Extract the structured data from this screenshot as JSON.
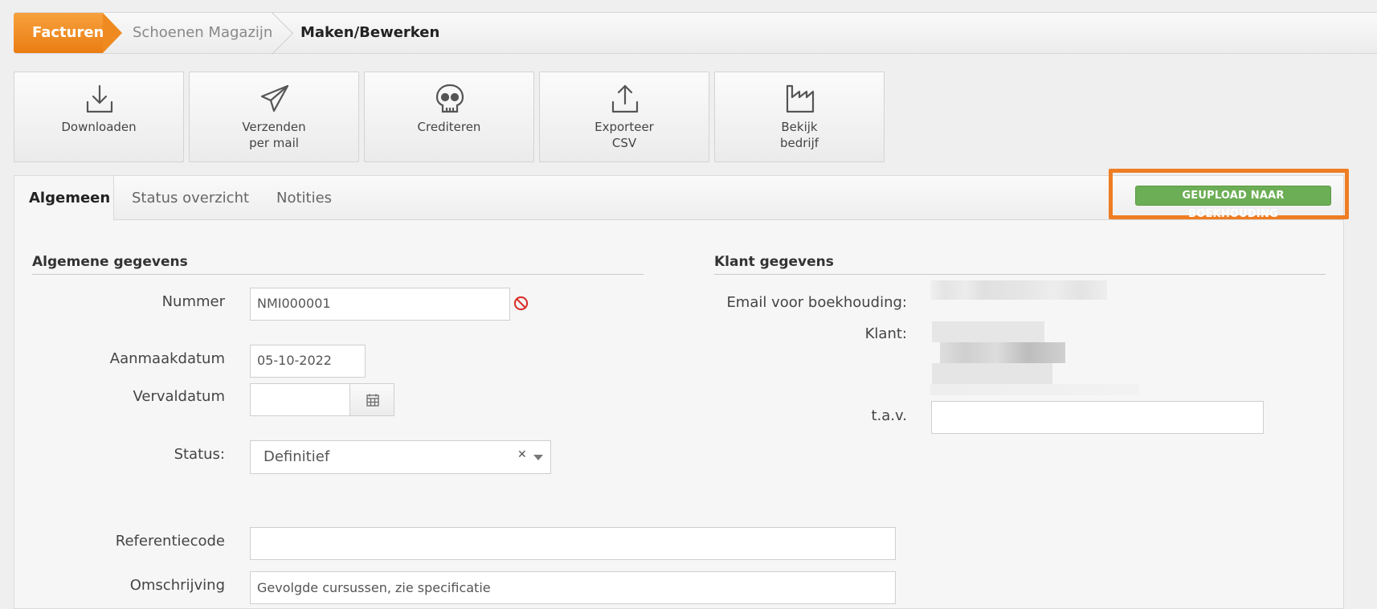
{
  "breadcrumb": {
    "items": [
      "Facturen",
      "Schoenen Magazijn",
      "Maken/Bewerken"
    ]
  },
  "toolbar": {
    "buttons": [
      {
        "icon": "download-icon",
        "lines": [
          "Downloaden"
        ]
      },
      {
        "icon": "paper-plane-icon",
        "lines": [
          "Verzenden",
          "per mail"
        ]
      },
      {
        "icon": "skull-icon",
        "lines": [
          "Crediteren"
        ]
      },
      {
        "icon": "upload-icon",
        "lines": [
          "Exporteer",
          "CSV"
        ]
      },
      {
        "icon": "factory-icon",
        "lines": [
          "Bekijk",
          "bedrijf"
        ]
      }
    ]
  },
  "tabs": {
    "items": [
      "Algemeen",
      "Status overzicht",
      "Notities"
    ],
    "active": "Algemeen"
  },
  "upload_badge": "GEUPLOAD NAAR BOEKHOUDING",
  "general": {
    "title": "Algemene gegevens",
    "number_label": "Nummer",
    "number_value": "NMI000001",
    "created_label": "Aanmaakdatum",
    "created_value": "05-10-2022",
    "due_label": "Vervaldatum",
    "due_value": "",
    "status_label": "Status:",
    "status_value": "Definitief",
    "reference_label": "Referentiecode",
    "reference_value": "",
    "description_label": "Omschrijving",
    "description_value": "Gevolgde cursussen, zie specificatie"
  },
  "client": {
    "title": "Klant gegevens",
    "email_label": "Email voor boekhouding:",
    "client_label": "Klant:",
    "attn_label": "t.a.v.",
    "attn_value": ""
  },
  "colors": {
    "accent_orange": "#ef8a20",
    "badge_green": "#6cae55",
    "highlight_orange": "#ee7d24",
    "error_red": "#d9302a"
  }
}
